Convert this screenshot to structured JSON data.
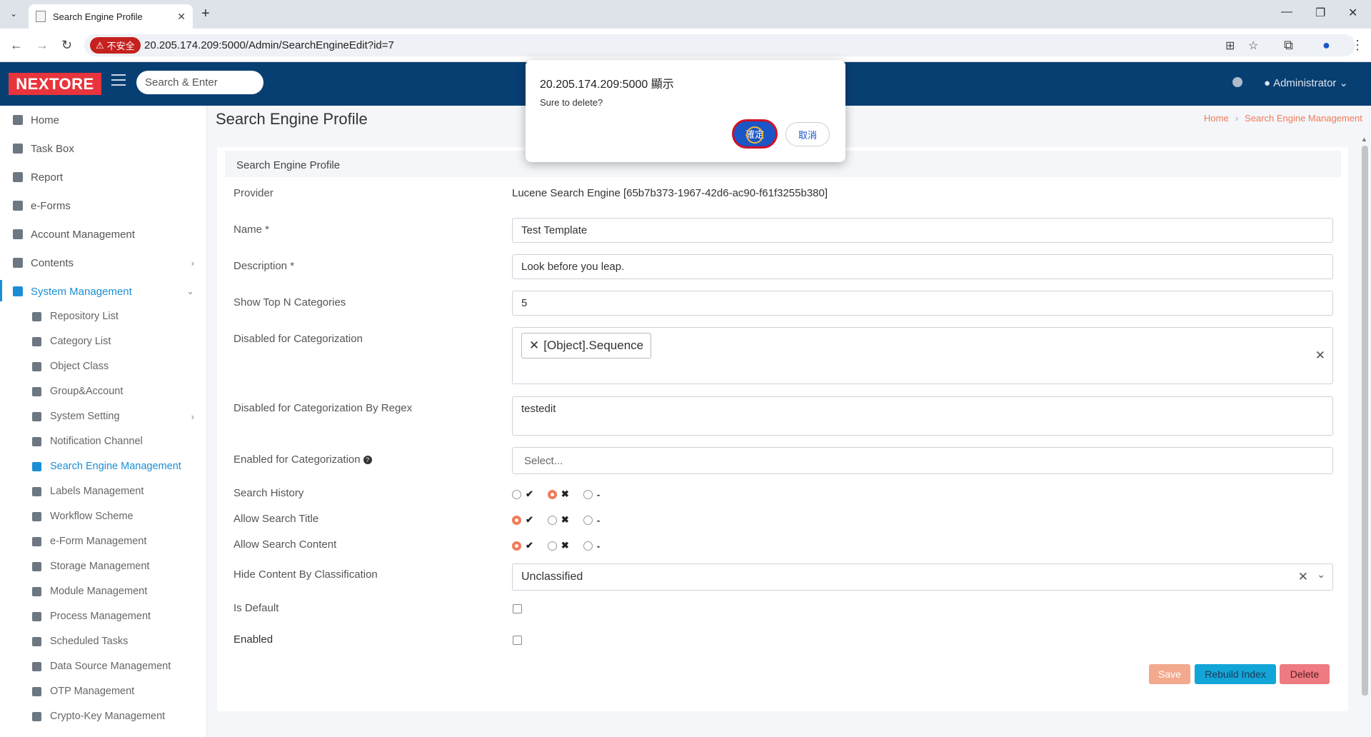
{
  "browser": {
    "tab_title": "Search Engine Profile",
    "security_label": "不安全",
    "url": "20.205.174.209:5000/Admin/SearchEngineEdit?id=7"
  },
  "header": {
    "logo": "NEXTORE",
    "search_placeholder": "Search & Enter",
    "user": "Administrator"
  },
  "sidebar": {
    "items": [
      {
        "label": "Home",
        "icon": "home-icon"
      },
      {
        "label": "Task Box",
        "icon": "tasks-icon"
      },
      {
        "label": "Report",
        "icon": "table-icon"
      },
      {
        "label": "e-Forms",
        "icon": "form-icon"
      },
      {
        "label": "Account Management",
        "icon": "user-icon"
      },
      {
        "label": "Contents",
        "icon": "folder-icon"
      },
      {
        "label": "System Management",
        "icon": "gears-icon"
      }
    ],
    "sub_items": [
      {
        "label": "Repository List"
      },
      {
        "label": "Category List"
      },
      {
        "label": "Object Class"
      },
      {
        "label": "Group&Account"
      },
      {
        "label": "System Setting"
      },
      {
        "label": "Notification Channel"
      },
      {
        "label": "Search Engine Management"
      },
      {
        "label": "Labels Management"
      },
      {
        "label": "Workflow Scheme"
      },
      {
        "label": "e-Form Management"
      },
      {
        "label": "Storage Management"
      },
      {
        "label": "Module Management"
      },
      {
        "label": "Process Management"
      },
      {
        "label": "Scheduled Tasks"
      },
      {
        "label": "Data Source Management"
      },
      {
        "label": "OTP Management"
      },
      {
        "label": "Crypto-Key Management"
      }
    ]
  },
  "page": {
    "title": "Search Engine Profile",
    "breadcrumb": [
      "Home",
      "Search Engine Management"
    ]
  },
  "form": {
    "card_title": "Search Engine Profile",
    "provider_label": "Provider",
    "provider_value": "Lucene Search Engine [65b7b373-1967-42d6-ac90-f61f3255b380]",
    "name_label": "Name *",
    "name_value": "Test Template",
    "description_label": "Description *",
    "description_value": "Look before you leap.",
    "topn_label": "Show Top N Categories",
    "topn_value": "5",
    "disabled_cat_label": "Disabled for Categorization",
    "disabled_cat_tag": "[Object].Sequence",
    "disabled_regex_label": "Disabled for Categorization By Regex",
    "disabled_regex_value": "testedit",
    "enabled_cat_label": "Enabled for Categorization",
    "enabled_cat_placeholder": "Select...",
    "search_history_label": "Search History",
    "allow_title_label": "Allow Search Title",
    "allow_content_label": "Allow Search Content",
    "radio_yes": "✔",
    "radio_no": "✖",
    "radio_none": "-",
    "search_history_selected": "no",
    "allow_title_selected": "yes",
    "allow_content_selected": "yes",
    "hide_content_label": "Hide Content By Classification",
    "hide_content_value": "Unclassified",
    "is_default_label": "Is Default",
    "enabled_label": "Enabled",
    "save_label": "Save",
    "rebuild_label": "Rebuild Index",
    "delete_label": "Delete"
  },
  "dialog": {
    "title": "20.205.174.209:5000 顯示",
    "message": "Sure to delete?",
    "ok_label": "確定",
    "cancel_label": "取消"
  }
}
